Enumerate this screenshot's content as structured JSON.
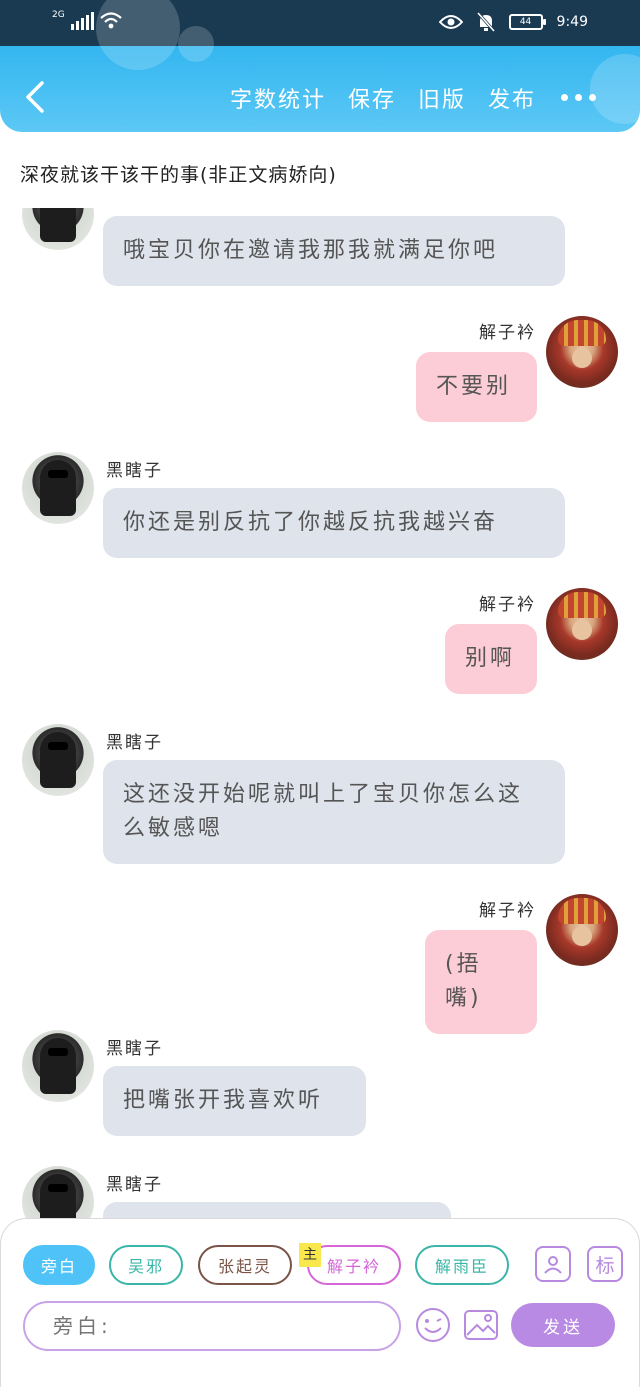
{
  "status_bar": {
    "network": "2G",
    "battery": "44",
    "time": "9:49"
  },
  "header": {
    "actions": [
      "字数统计",
      "保存",
      "旧版",
      "发布"
    ]
  },
  "page_title": "深夜就该干该干的事(非正文病娇向)",
  "messages": [
    {
      "side": "left",
      "name": "",
      "text": "哦宝贝你在邀请我那我就满足你吧"
    },
    {
      "side": "right",
      "name": "解子衿",
      "text": "不要别"
    },
    {
      "side": "left",
      "name": "黑瞎子",
      "text": "你还是别反抗了你越反抗我越兴奋"
    },
    {
      "side": "right",
      "name": "解子衿",
      "text": "别啊"
    },
    {
      "side": "left",
      "name": "黑瞎子",
      "text": "这还没开始呢就叫上了宝贝你怎么这么敏感嗯"
    },
    {
      "side": "right",
      "name": "解子衿",
      "text": "(捂嘴)"
    },
    {
      "side": "left",
      "name": "黑瞎子",
      "text": "把嘴张开我喜欢听"
    },
    {
      "side": "left",
      "name": "黑瞎子",
      "text": ""
    }
  ],
  "composer": {
    "roles": [
      {
        "label": "旁白",
        "color": "#4fc3f7"
      },
      {
        "label": "吴邪",
        "color": "#3ab5a8"
      },
      {
        "label": "张起灵",
        "color": "#7a5446"
      },
      {
        "label": "解子衿",
        "color": "#d466d8"
      },
      {
        "label": "解雨臣",
        "color": "#3ab5a8"
      }
    ],
    "main_badge": "主",
    "mark_label": "标",
    "input_placeholder": "旁白:",
    "send_label": "发送"
  }
}
